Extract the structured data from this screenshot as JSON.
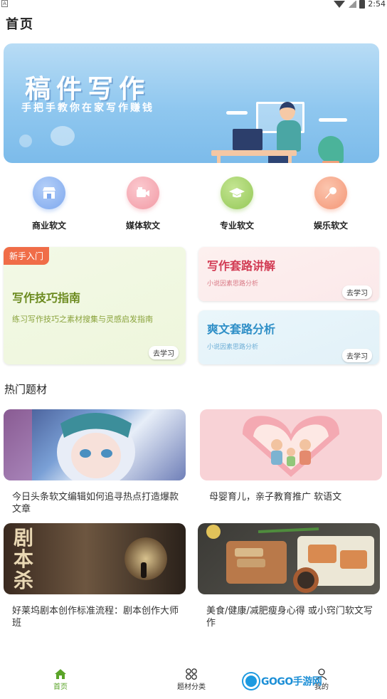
{
  "status": {
    "time": "2:54",
    "left_indicator": "A"
  },
  "header": {
    "title": "首页"
  },
  "banner": {
    "title": "稿件写作",
    "subtitle": "手把手教你在家写作赚钱"
  },
  "categories": [
    {
      "label": "商业软文",
      "icon": "shop-icon",
      "color": "#8fb6f2"
    },
    {
      "label": "媒体软文",
      "icon": "media-icon",
      "color": "#f5a7b0"
    },
    {
      "label": "专业软文",
      "icon": "graduation-cap-icon",
      "color": "#a5d46a"
    },
    {
      "label": "娱乐软文",
      "icon": "microphone-icon",
      "color": "#f7a88a"
    }
  ],
  "cards": {
    "big": {
      "badge": "新手入门",
      "title": "写作技巧指南",
      "desc": "练习写作技巧之素材搜集与灵感启发指南",
      "button": "去学习"
    },
    "right1": {
      "title": "写作套路讲解",
      "desc": "小说因素思路分析",
      "button": "去学习"
    },
    "right2": {
      "title": "爽文套路分析",
      "desc": "小说因素思路分析",
      "button": "去学习"
    }
  },
  "hot": {
    "title": "热门题材",
    "items": [
      {
        "text": "今日头条软文编辑如何追寻热点打造爆款文章"
      },
      {
        "text": "母婴育儿，亲子教育推广 软语文"
      },
      {
        "text": "好莱坞剧本创作标准流程：剧本创作大师班",
        "image_text": "剧本杀"
      },
      {
        "text": "美食/健康/减肥瘦身心得 或小窍门软文写作"
      }
    ]
  },
  "nav": {
    "items": [
      {
        "label": "首页",
        "icon": "home-icon",
        "active": true
      },
      {
        "label": "题材分类",
        "icon": "grid-icon",
        "active": false
      },
      {
        "label": "我的",
        "icon": "user-icon",
        "active": false
      }
    ],
    "watermark": "GOGO手游网"
  },
  "colors": {
    "accent_green": "#5aa428",
    "pink_title": "#d23c54",
    "blue_title": "#2f8fc7"
  }
}
